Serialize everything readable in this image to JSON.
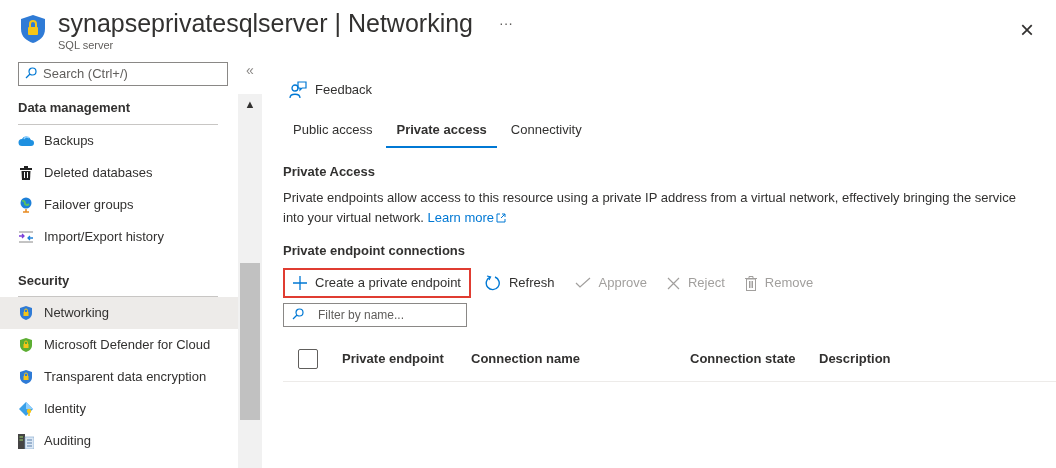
{
  "header": {
    "title": "synapseprivatesqlserver | Networking",
    "subtitle": "SQL server",
    "more": "···",
    "close": "×"
  },
  "sidebar": {
    "search": {
      "placeholder": "Search (Ctrl+/)"
    },
    "collapse": "«",
    "scroll_up": "▲",
    "groups": [
      {
        "title": "Data management",
        "items": [
          {
            "label": "Backups",
            "selected": false
          },
          {
            "label": "Deleted databases",
            "selected": false
          },
          {
            "label": "Failover groups",
            "selected": false
          },
          {
            "label": "Import/Export history",
            "selected": false
          }
        ]
      },
      {
        "title": "Security",
        "items": [
          {
            "label": "Networking",
            "selected": true
          },
          {
            "label": "Microsoft Defender for Cloud",
            "selected": false
          },
          {
            "label": "Transparent data encryption",
            "selected": false
          },
          {
            "label": "Identity",
            "selected": false
          },
          {
            "label": "Auditing",
            "selected": false
          }
        ]
      }
    ]
  },
  "feedback": "Feedback",
  "tabs": [
    {
      "label": "Public access",
      "selected": false
    },
    {
      "label": "Private access",
      "selected": true
    },
    {
      "label": "Connectivity",
      "selected": false
    }
  ],
  "section": {
    "title": "Private Access",
    "description": "Private endpoints allow access to this resource using a private IP address from a virtual network, effectively bringing the service into your virtual network.",
    "link": "Learn more"
  },
  "connections": {
    "title": "Private endpoint connections",
    "toolbar": [
      {
        "label": "Create a private endpoint",
        "disabled": false,
        "highlighted": true
      },
      {
        "label": "Refresh",
        "disabled": false,
        "highlighted": false
      },
      {
        "label": "Approve",
        "disabled": true,
        "highlighted": false
      },
      {
        "label": "Reject",
        "disabled": true,
        "highlighted": false
      },
      {
        "label": "Remove",
        "disabled": true,
        "highlighted": false
      }
    ],
    "filter": {
      "placeholder": "Filter by name..."
    },
    "table": {
      "select_all_checked": false,
      "columns": [
        "Private endpoint",
        "Connection name",
        "Connection state",
        "Description"
      ]
    }
  }
}
